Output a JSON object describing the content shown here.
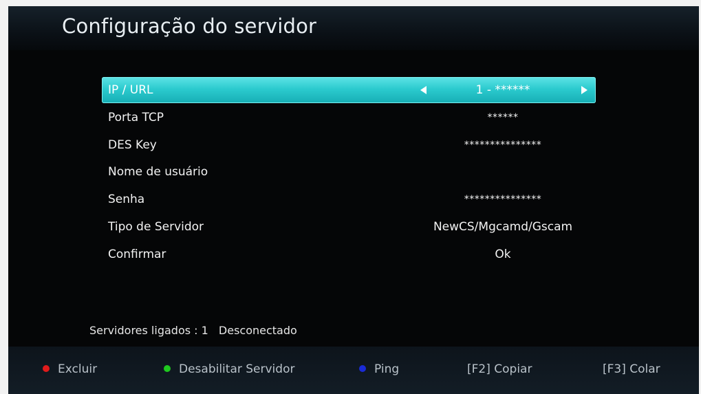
{
  "header": {
    "title": "Configuração do servidor"
  },
  "menu": {
    "items": [
      {
        "label": "IP / URL",
        "value": "1 - ******",
        "selected": true
      },
      {
        "label": "Porta TCP",
        "value": "******"
      },
      {
        "label": "DES Key",
        "value": "***************"
      },
      {
        "label": "Nome de usuário",
        "value": ""
      },
      {
        "label": "Senha",
        "value": "***************"
      },
      {
        "label": "Tipo de Servidor",
        "value": "NewCS/Mgcamd/Gscam"
      },
      {
        "label": "Confirmar",
        "value": "Ok"
      }
    ]
  },
  "status": {
    "servers_label": "Servidores ligados : 1",
    "connection": "Desconectado"
  },
  "footer": {
    "excluir": {
      "label": "Excluir",
      "color": "#e01b1b"
    },
    "desabilitar": {
      "label": "Desabilitar Servidor",
      "color": "#1fc91f"
    },
    "ping": {
      "label": "Ping",
      "color": "#1a2bd6"
    },
    "copiar": {
      "label": "[F2]  Copiar"
    },
    "colar": {
      "label": "[F3]  Colar"
    }
  },
  "colors": {
    "selected_row": "#2ccbcf",
    "background": "#050607"
  }
}
